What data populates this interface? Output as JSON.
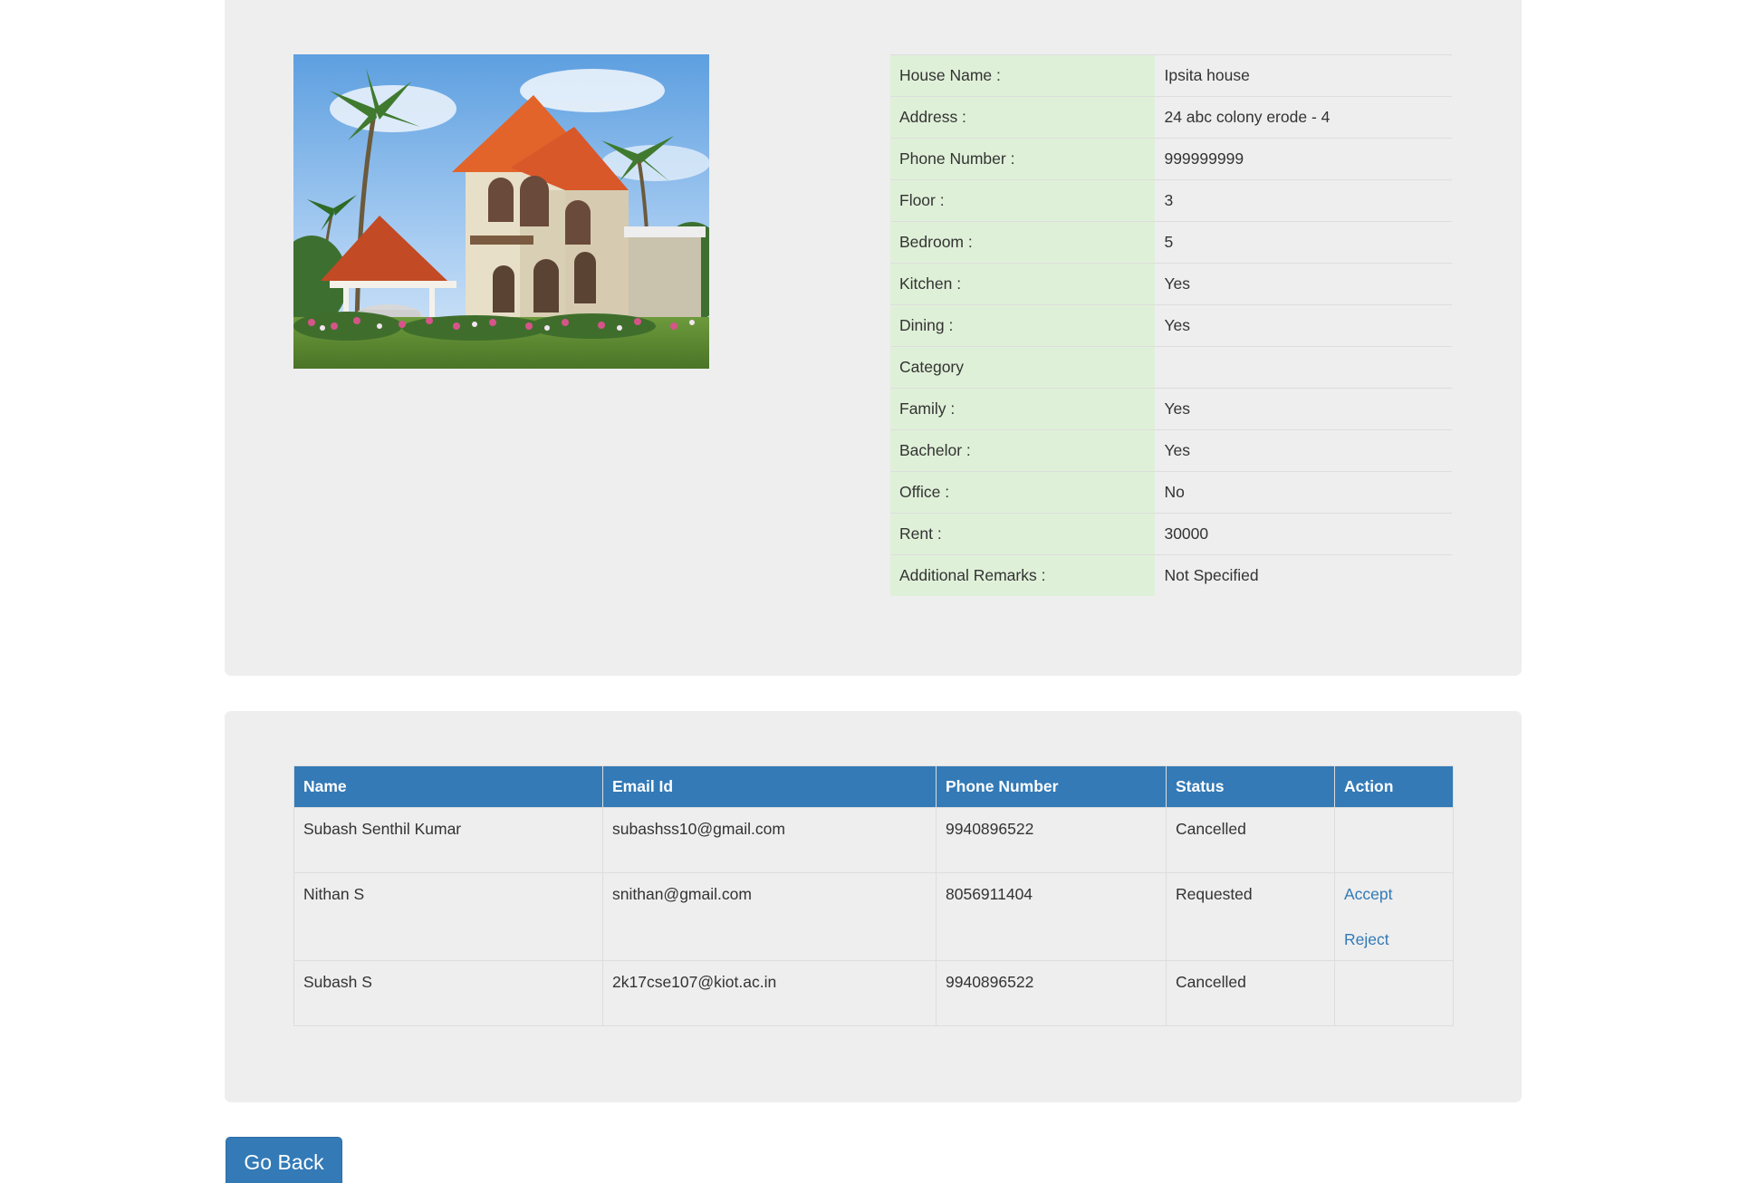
{
  "house_details": {
    "image_alt": "House photo",
    "rows": [
      {
        "label": "House Name :",
        "value": "Ipsita house"
      },
      {
        "label": "Address :",
        "value": "24 abc colony erode - 4"
      },
      {
        "label": "Phone Number :",
        "value": "999999999"
      },
      {
        "label": "Floor :",
        "value": "3"
      },
      {
        "label": "Bedroom :",
        "value": "5"
      },
      {
        "label": "Kitchen :",
        "value": "Yes"
      },
      {
        "label": "Dining :",
        "value": "Yes"
      },
      {
        "label": "Category",
        "value": ""
      },
      {
        "label": "Family :",
        "value": "Yes"
      },
      {
        "label": "Bachelor :",
        "value": "Yes"
      },
      {
        "label": "Office :",
        "value": "No"
      },
      {
        "label": "Rent :",
        "value": "30000"
      },
      {
        "label": "Additional Remarks :",
        "value": "Not Specified"
      }
    ]
  },
  "requests": {
    "headers": {
      "name": "Name",
      "email": "Email Id",
      "phone": "Phone Number",
      "status": "Status",
      "action": "Action"
    },
    "rows": [
      {
        "name": "Subash Senthil Kumar",
        "email": "subashss10@gmail.com",
        "phone": "9940896522",
        "status": "Cancelled",
        "accept": "",
        "reject": ""
      },
      {
        "name": "Nithan S",
        "email": "snithan@gmail.com",
        "phone": "8056911404",
        "status": "Requested",
        "accept": "Accept",
        "reject": "Reject"
      },
      {
        "name": "Subash S",
        "email": "2k17cse107@kiot.ac.in",
        "phone": "9940896522",
        "status": "Cancelled",
        "accept": "",
        "reject": ""
      }
    ]
  },
  "go_back_label": "Go Back",
  "colors": {
    "primary": "#337ab7",
    "label_background": "#dff0d8",
    "panel_background": "#eeeeee"
  }
}
